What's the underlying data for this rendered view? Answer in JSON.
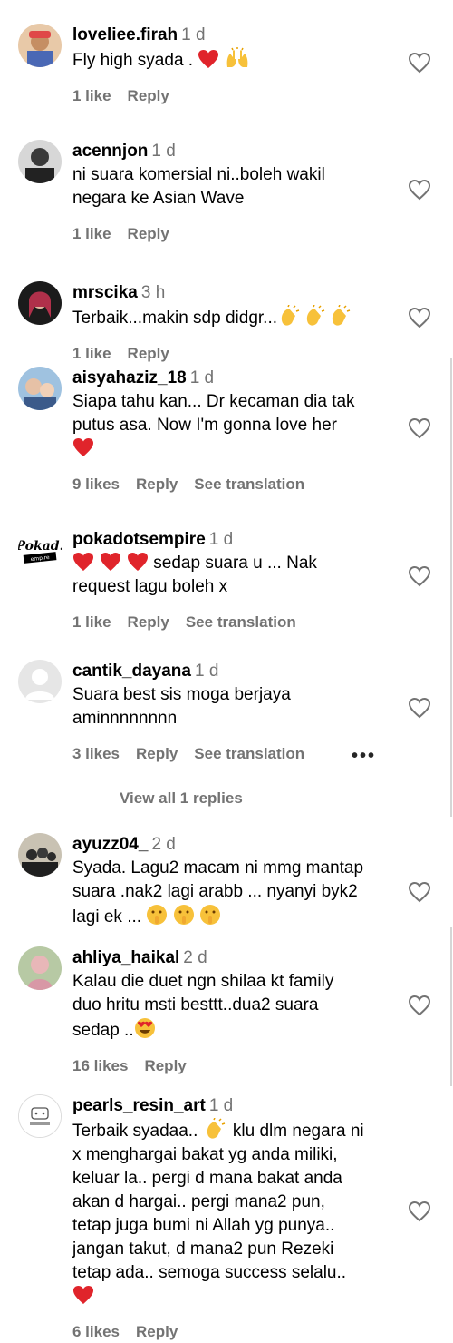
{
  "comments": [
    {
      "username": "loveliee.firah",
      "time": "1 d",
      "lines": [
        "Fly high syada ."
      ],
      "emoji_suffix": [
        "red-heart",
        "raised-hands"
      ],
      "actions": [
        "1 like",
        "Reply"
      ]
    },
    {
      "username": "acennjon",
      "time": "1 d",
      "lines": [
        "ni suara komersial ni..boleh wakil",
        "negara ke Asian Wave"
      ],
      "actions": [
        "1 like",
        "Reply"
      ]
    },
    {
      "username": "mrscika",
      "time": "3 h",
      "lines": [
        "Terbaik...makin sdp didgr..."
      ],
      "emoji_suffix": [
        "clapping-hands",
        "clapping-hands",
        "clapping-hands"
      ],
      "actions": [
        "1 like",
        "Reply"
      ]
    },
    {
      "username": "aisyahaziz_18",
      "time": "1 d",
      "lines": [
        "Siapa tahu kan... Dr kecaman dia tak",
        "putus asa. Now I'm gonna love her"
      ],
      "emoji_line": [
        "red-heart"
      ],
      "actions": [
        "9 likes",
        "Reply",
        "See translation"
      ]
    },
    {
      "username": "pokadotsempire",
      "time": "1 d",
      "first_line_after_emoji": "sedap suara u ... Nak",
      "emoji_prefix": [
        "red-heart",
        "red-heart",
        "red-heart"
      ],
      "lines": [
        "request lagu boleh x"
      ],
      "actions": [
        "1 like",
        "Reply",
        "See translation"
      ]
    },
    {
      "username": "cantik_dayana",
      "time": "1 d",
      "lines": [
        "Suara best sis moga berjaya",
        "aminnnnnnnn"
      ],
      "actions": [
        "3 likes",
        "Reply",
        "See translation"
      ]
    },
    {
      "username": "ayuzz04_",
      "time": "2 d",
      "lines": [
        "Syada. Lagu2 macam ni mmg mantap",
        "suara .nak2 lagi arabb ... nyanyi byk2",
        "lagi ek ..."
      ],
      "emoji_suffix": [
        "shushing-face",
        "shushing-face",
        "shushing-face"
      ]
    },
    {
      "username": "ahliya_haikal",
      "time": "2 d",
      "lines": [
        "Kalau die duet ngn shilaa kt family",
        "duo hritu msti besttt..dua2 suara",
        "sedap .."
      ],
      "emoji_suffix": [
        "heart-eyes-face"
      ],
      "actions": [
        "16 likes",
        "Reply"
      ]
    },
    {
      "username": "pearls_resin_art",
      "time": "1 d",
      "lines": [
        "Terbaik syadaa..",
        "x menghargai bakat yg anda miliki,",
        "keluar la.. pergi d mana bakat anda",
        "akan d hargai.. pergi mana2 pun,",
        "tetap juga bumi ni Allah yg punya..",
        "jangan takut, d mana2 pun Rezeki",
        "tetap ada.. semoga success selalu.."
      ],
      "first_line_tail": "klu dlm negara ni",
      "emoji_mid": [
        "clapping-hands"
      ],
      "emoji_line": [
        "red-heart"
      ],
      "actions": [
        "6 likes",
        "Reply"
      ]
    }
  ],
  "view_replies": "View all 1 replies",
  "more_label": "•••",
  "icons": {
    "like": "heart-outline-icon",
    "more": "more-options-icon"
  },
  "colors": {
    "secondary_text": "#737373",
    "heart": "#e0245e",
    "border": "#dbdbdb"
  }
}
